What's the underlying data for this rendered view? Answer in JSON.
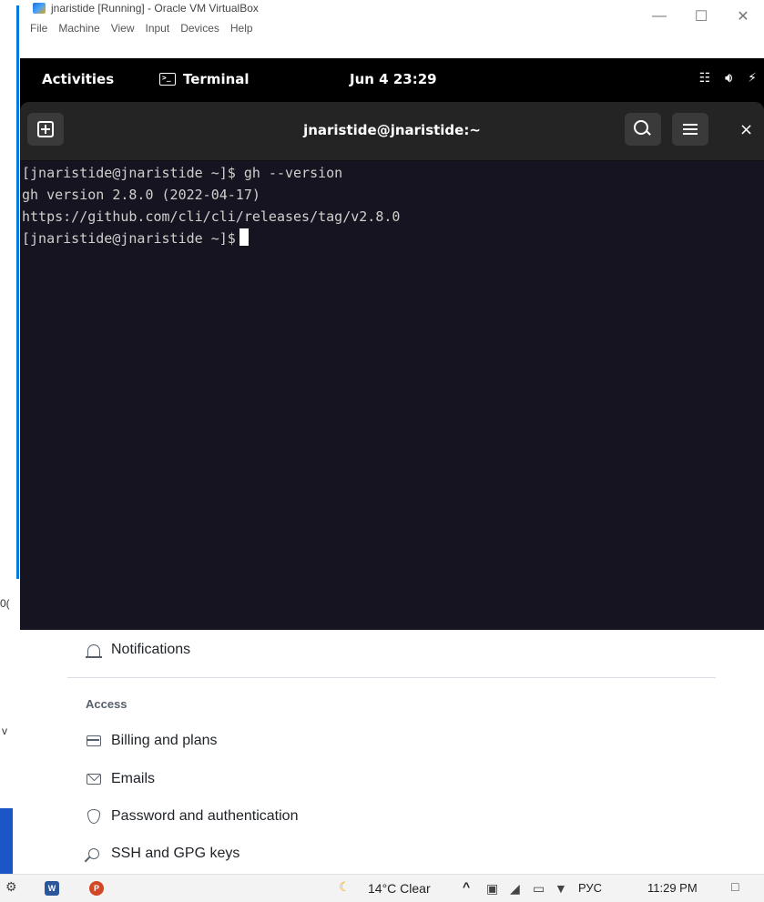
{
  "vbox": {
    "title": "jnaristide [Running] - Oracle VM VirtualBox",
    "menu": [
      "File",
      "Machine",
      "View",
      "Input",
      "Devices",
      "Help"
    ],
    "controls": {
      "minimize": "—",
      "maximize": "☐",
      "close": "✕"
    }
  },
  "gnome": {
    "activities": "Activities",
    "app_name": "Terminal",
    "clock": "Jun 4  23:29",
    "status_icons": [
      "network-icon",
      "volume-icon",
      "battery-icon"
    ]
  },
  "terminal": {
    "title": "jnaristide@jnaristide:~",
    "close": "×",
    "lines": [
      "[jnaristide@jnaristide ~]$ gh --version",
      "gh version 2.8.0 (2022-04-17)",
      "https://github.com/cli/cli/releases/tag/v2.8.0"
    ],
    "prompt": "[jnaristide@jnaristide ~]$"
  },
  "host_page": {
    "notifications": "Notifications",
    "access_heading": "Access",
    "items": [
      "Billing and plans",
      "Emails",
      "Password and authentication",
      "SSH and GPG keys"
    ]
  },
  "host_fragments": {
    "left_a": "0(",
    "left_b": "v"
  },
  "taskbar": {
    "weather": "14°C  Clear",
    "language": "РУС",
    "time": "11:29 PM",
    "up_arrow": "^"
  }
}
